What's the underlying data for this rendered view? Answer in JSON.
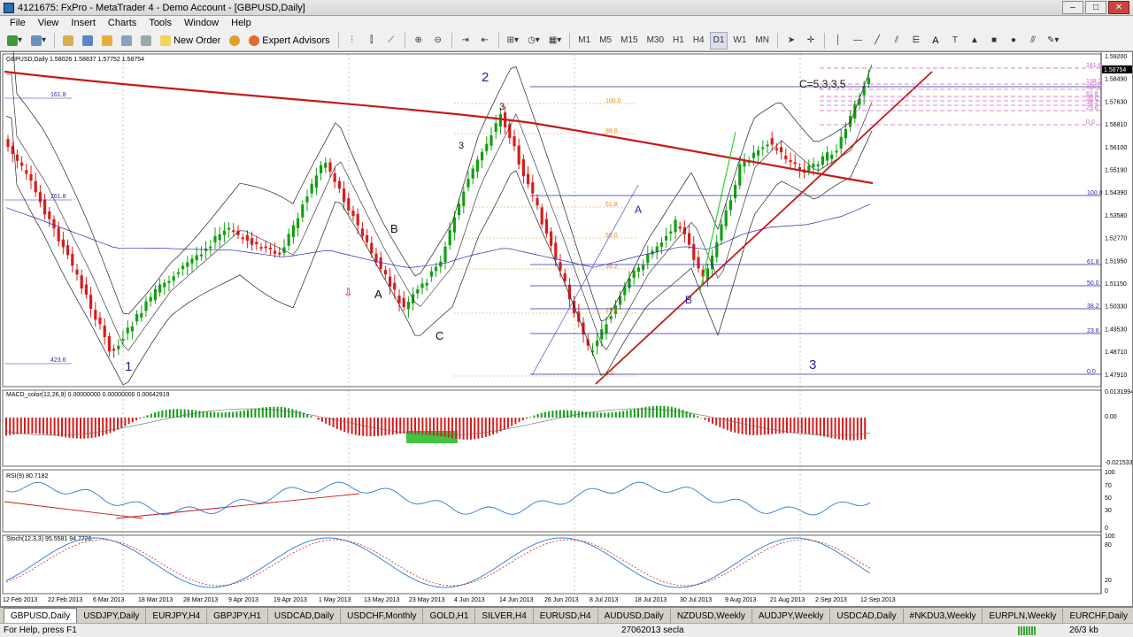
{
  "window": {
    "title": "4121675: FxPro - MetaTrader 4 - Demo Account - [GBPUSD,Daily]"
  },
  "menu": [
    "File",
    "View",
    "Insert",
    "Charts",
    "Tools",
    "Window",
    "Help"
  ],
  "toolbar": {
    "new_order": "New Order",
    "expert_advisors": "Expert Advisors",
    "periods": [
      "M1",
      "M5",
      "M15",
      "M30",
      "H1",
      "H4",
      "D1",
      "W1",
      "MN"
    ],
    "labels": [
      "A"
    ]
  },
  "chart": {
    "info": "GBPUSD,Daily  1.58026 1.58837 1.57752 1.58754",
    "current_price": "1.58754",
    "price_scale": [
      "1.59200",
      "1.58490",
      "1.57630",
      "1.56810",
      "1.56100",
      "1.55190",
      "1.54390",
      "1.53580",
      "1.52770",
      "1.51950",
      "1.51150",
      "1.50330",
      "1.49530",
      "1.48710",
      "1.47910"
    ],
    "date_scale": [
      "12 Feb 2013",
      "22 Feb 2013",
      "6 Mar 2013",
      "18 Mar 2013",
      "28 Mar 2013",
      "9 Apr 2013",
      "19 Apr 2013",
      "1 May 2013",
      "13 May 2013",
      "23 May 2013",
      "4 Jun 2013",
      "14 Jun 2013",
      "26 Jun 2013",
      "8 Jul 2013",
      "18 Jul 2013",
      "30 Jul 2013",
      "9 Aug 2013",
      "21 Aug 2013",
      "2 Sep 2013",
      "12 Sep 2013"
    ],
    "wave_labels": [
      "1",
      "2",
      "3",
      "A",
      "B",
      "C",
      "A",
      "B",
      "3",
      "3",
      "C=5,3,3,5"
    ],
    "fib_left": [
      "161.8",
      "261.8",
      "423.6"
    ],
    "fib_mid": [
      "100.0",
      "88.6",
      "61.8",
      "50.0",
      "38.2",
      "23.6",
      "0.0"
    ],
    "fib_right": [
      "100.0",
      "61.8",
      "50.0",
      "38.2",
      "23.6",
      "0.0"
    ],
    "fib_top": [
      "161.8",
      "138.2",
      "100.0",
      "61.8",
      "50.0",
      "38.2",
      "23.6",
      "0.0"
    ]
  },
  "macd": {
    "title": "MACD_color(12,26,9) 0.00000000 0.00000000 0.00642919",
    "scale": [
      "0.0131994",
      "0.00",
      "-0.0215336"
    ]
  },
  "rsi": {
    "title": "RSI(9) 80.7182",
    "scale": [
      "100",
      "70",
      "50",
      "30",
      "0"
    ]
  },
  "stoch": {
    "title": "Stoch(12,3,3) 95.5581 94.7726",
    "scale": [
      "100",
      "80",
      "20",
      "0"
    ]
  },
  "tabs": [
    "GBPUSD,Daily",
    "USDJPY,Daily",
    "EURJPY,H4",
    "GBPJPY,H1",
    "USDCAD,Daily",
    "USDCHF,Monthly",
    "GOLD,H1",
    "SILVER,H4",
    "EURUSD,H4",
    "AUDUSD,Daily",
    "NZDUSD,Weekly",
    "AUDJPY,Weekly",
    "USDCAD,Daily",
    "#NKDU3,Weekly",
    "EURPLN,Weekly",
    "EURCHF,Daily"
  ],
  "status": {
    "help": "For Help, press F1",
    "profile": "27062013 secla",
    "traffic": "26/3 kb"
  },
  "colors": {
    "bull": "#11a011",
    "bear": "#d81c1c",
    "ma": "#c41a1a",
    "fib_text": "#e58a1e",
    "fib_pink": "#d060c8",
    "blue_fib": "#2c2ca0"
  }
}
